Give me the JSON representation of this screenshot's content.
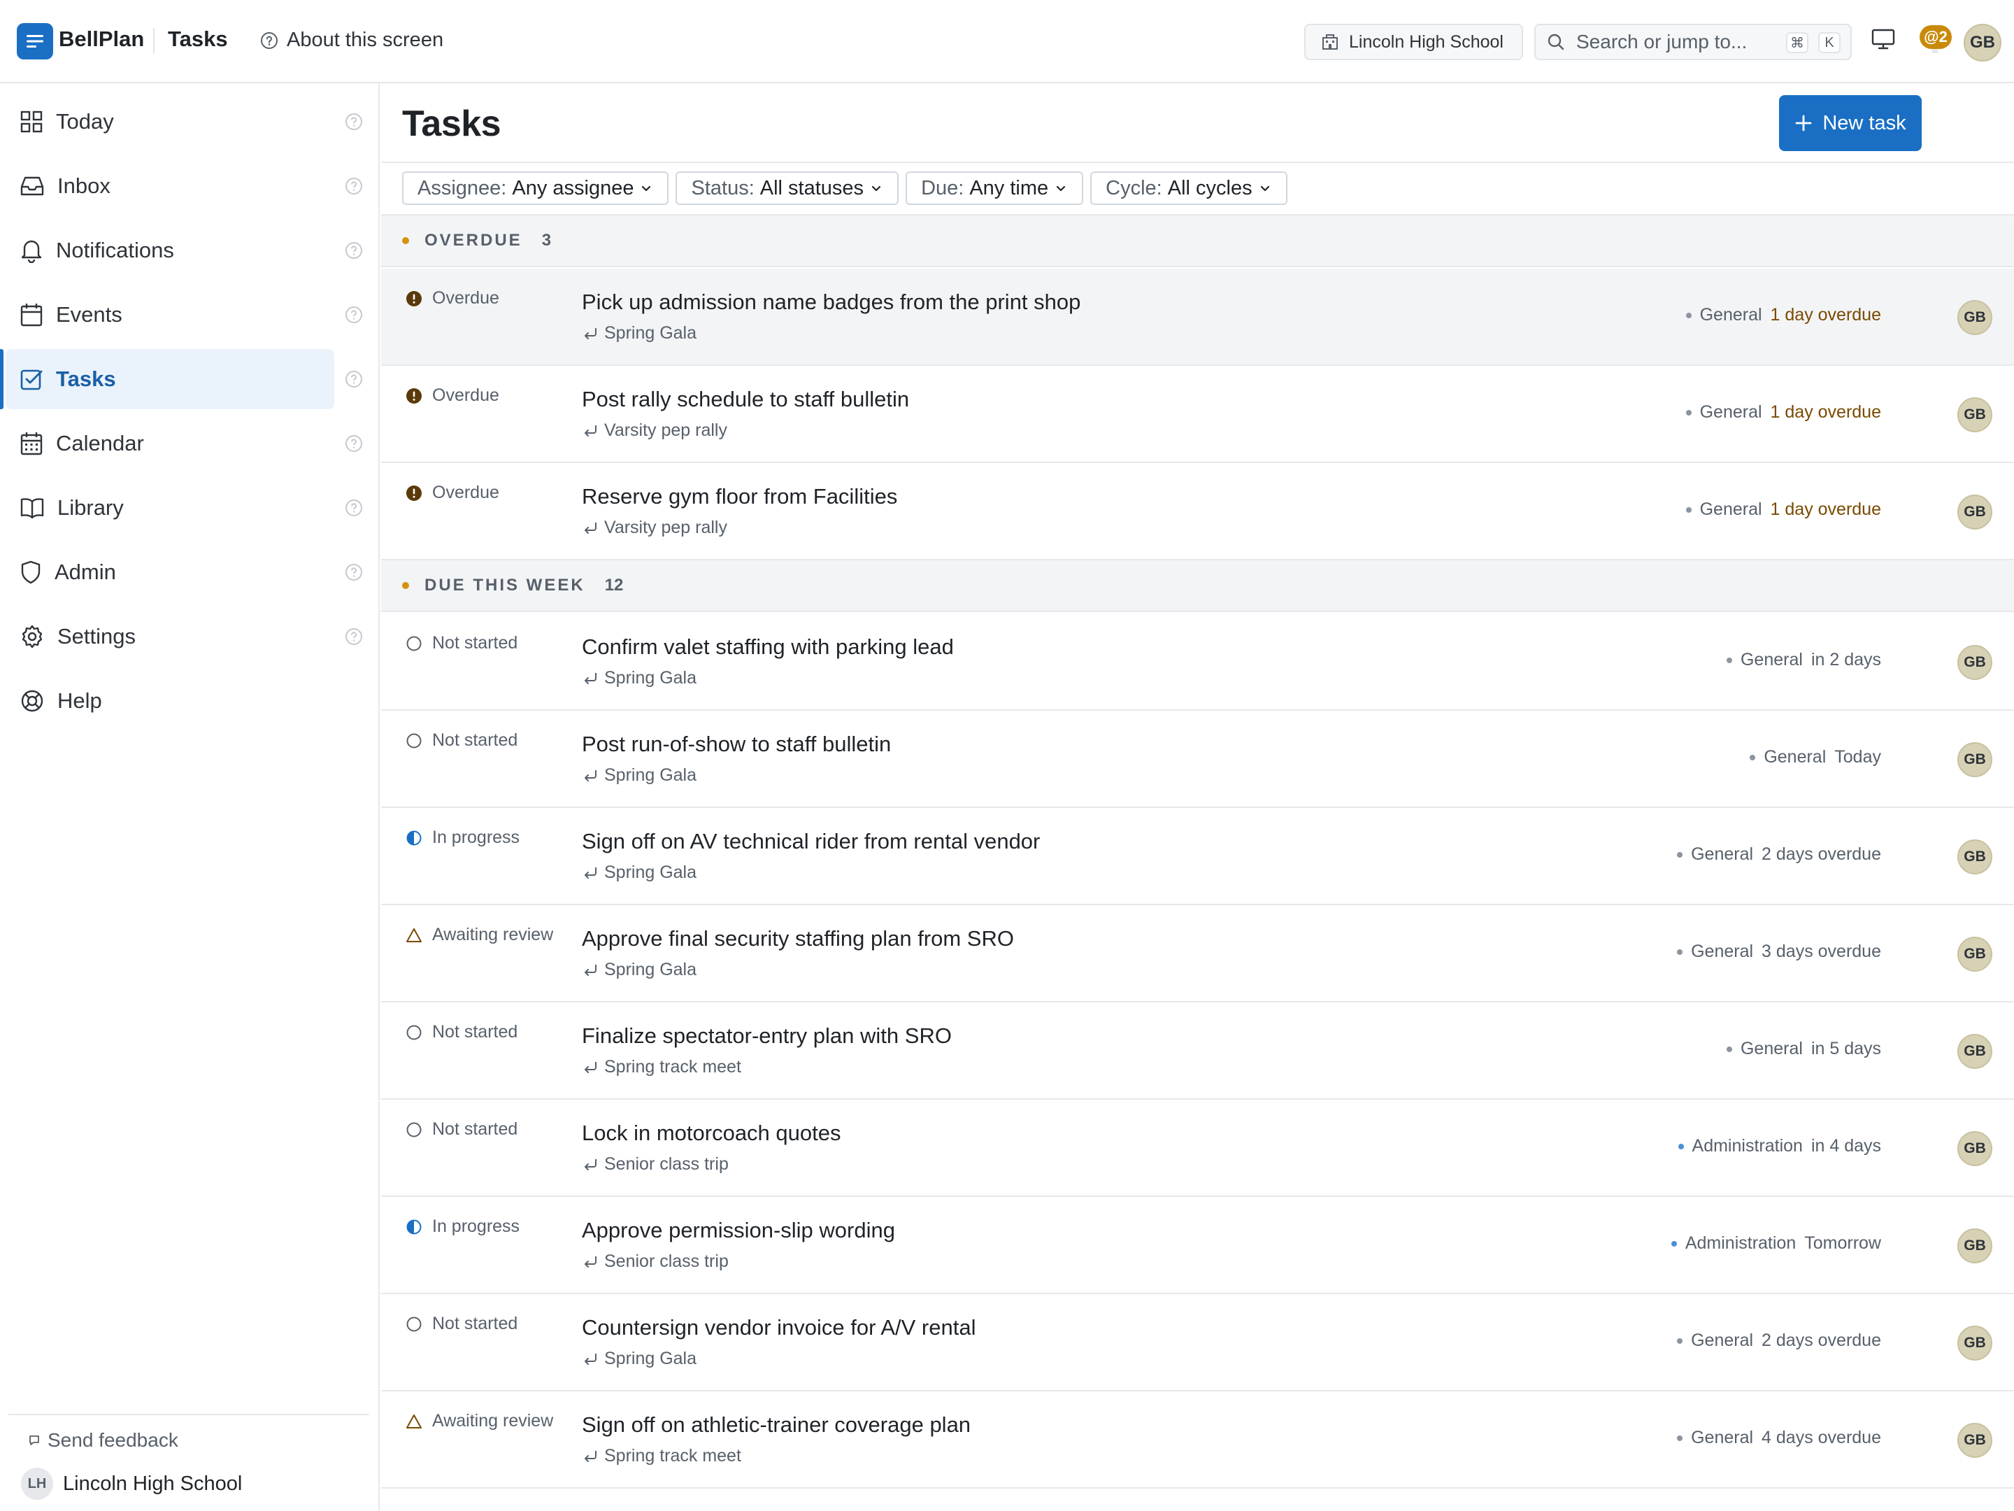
{
  "app": {
    "brand": "BellPlan",
    "section": "Tasks",
    "about_label": "About this screen",
    "school_chip": "Lincoln High School",
    "search_placeholder": "Search or jump to...",
    "search_shortcut_cmd": "⌘",
    "search_shortcut_key": "K",
    "mentions_badge": "@2",
    "user_initials": "GB"
  },
  "sidebar": {
    "items": [
      {
        "label": "Today",
        "icon": "grid-icon"
      },
      {
        "label": "Inbox",
        "icon": "inbox-icon"
      },
      {
        "label": "Notifications",
        "icon": "bell-icon"
      },
      {
        "label": "Events",
        "icon": "calendar-blank-icon"
      },
      {
        "label": "Tasks",
        "icon": "checkbox-icon",
        "active": true
      },
      {
        "label": "Calendar",
        "icon": "calendar-icon"
      },
      {
        "label": "Library",
        "icon": "book-icon"
      },
      {
        "label": "Admin",
        "icon": "shield-icon"
      },
      {
        "label": "Settings",
        "icon": "gear-icon"
      },
      {
        "label": "Help",
        "icon": "lifebuoy-icon"
      }
    ],
    "feedback_label": "Send feedback",
    "org_initials": "LH",
    "org_name": "Lincoln High School"
  },
  "main": {
    "title": "Tasks",
    "new_task_label": "New task",
    "filters": [
      {
        "key": "Assignee:",
        "value": "Any assignee"
      },
      {
        "key": "Status:",
        "value": "All statuses"
      },
      {
        "key": "Due:",
        "value": "Any time"
      },
      {
        "key": "Cycle:",
        "value": "All cycles"
      }
    ],
    "groups": [
      {
        "label": "OVERDUE",
        "count": "3"
      },
      {
        "label": "DUE THIS WEEK",
        "count": "12"
      }
    ],
    "tasks": [
      {
        "status": "Overdue",
        "title": "Pick up admission name badges from the print shop",
        "parent": "Spring Gala",
        "category": "General",
        "due": "1 day overdue",
        "assignee": "GB"
      },
      {
        "status": "Overdue",
        "title": "Post rally schedule to staff bulletin",
        "parent": "Varsity pep rally",
        "category": "General",
        "due": "1 day overdue",
        "assignee": "GB"
      },
      {
        "status": "Overdue",
        "title": "Reserve gym floor from Facilities",
        "parent": "Varsity pep rally",
        "category": "General",
        "due": "1 day overdue",
        "assignee": "GB"
      },
      {
        "status": "Not started",
        "title": "Confirm valet staffing with parking lead",
        "parent": "Spring Gala",
        "category": "General",
        "due": "in 2 days",
        "assignee": "GB"
      },
      {
        "status": "Not started",
        "title": "Post run-of-show to staff bulletin",
        "parent": "Spring Gala",
        "category": "General",
        "due": "Today",
        "assignee": "GB"
      },
      {
        "status": "In progress",
        "title": "Sign off on AV technical rider from rental vendor",
        "parent": "Spring Gala",
        "category": "General",
        "due": "2 days overdue",
        "assignee": "GB"
      },
      {
        "status": "Awaiting review",
        "title": "Approve final security staffing plan from SRO",
        "parent": "Spring Gala",
        "category": "General",
        "due": "3 days overdue",
        "assignee": "GB"
      },
      {
        "status": "Not started",
        "title": "Finalize spectator-entry plan with SRO",
        "parent": "Spring track meet",
        "category": "General",
        "due": "in 5 days",
        "assignee": "GB"
      },
      {
        "status": "Not started",
        "title": "Lock in motorcoach quotes",
        "parent": "Senior class trip",
        "category": "Administration",
        "due": "in 4 days",
        "assignee": "GB"
      },
      {
        "status": "In progress",
        "title": "Approve permission-slip wording",
        "parent": "Senior class trip",
        "category": "Administration",
        "due": "Tomorrow",
        "assignee": "GB"
      },
      {
        "status": "Not started",
        "title": "Countersign vendor invoice for A/V rental",
        "parent": "Spring Gala",
        "category": "General",
        "due": "2 days overdue",
        "assignee": "GB"
      },
      {
        "status": "Awaiting review",
        "title": "Sign off on athletic-trainer coverage plan",
        "parent": "Spring track meet",
        "category": "General",
        "due": "4 days overdue",
        "assignee": "GB"
      }
    ]
  },
  "colors": {
    "accent": "#1a6fc4",
    "overdue_text": "#7a4a00",
    "group_dot": "#d4920f",
    "mentions_badge": "#c98a0a"
  }
}
